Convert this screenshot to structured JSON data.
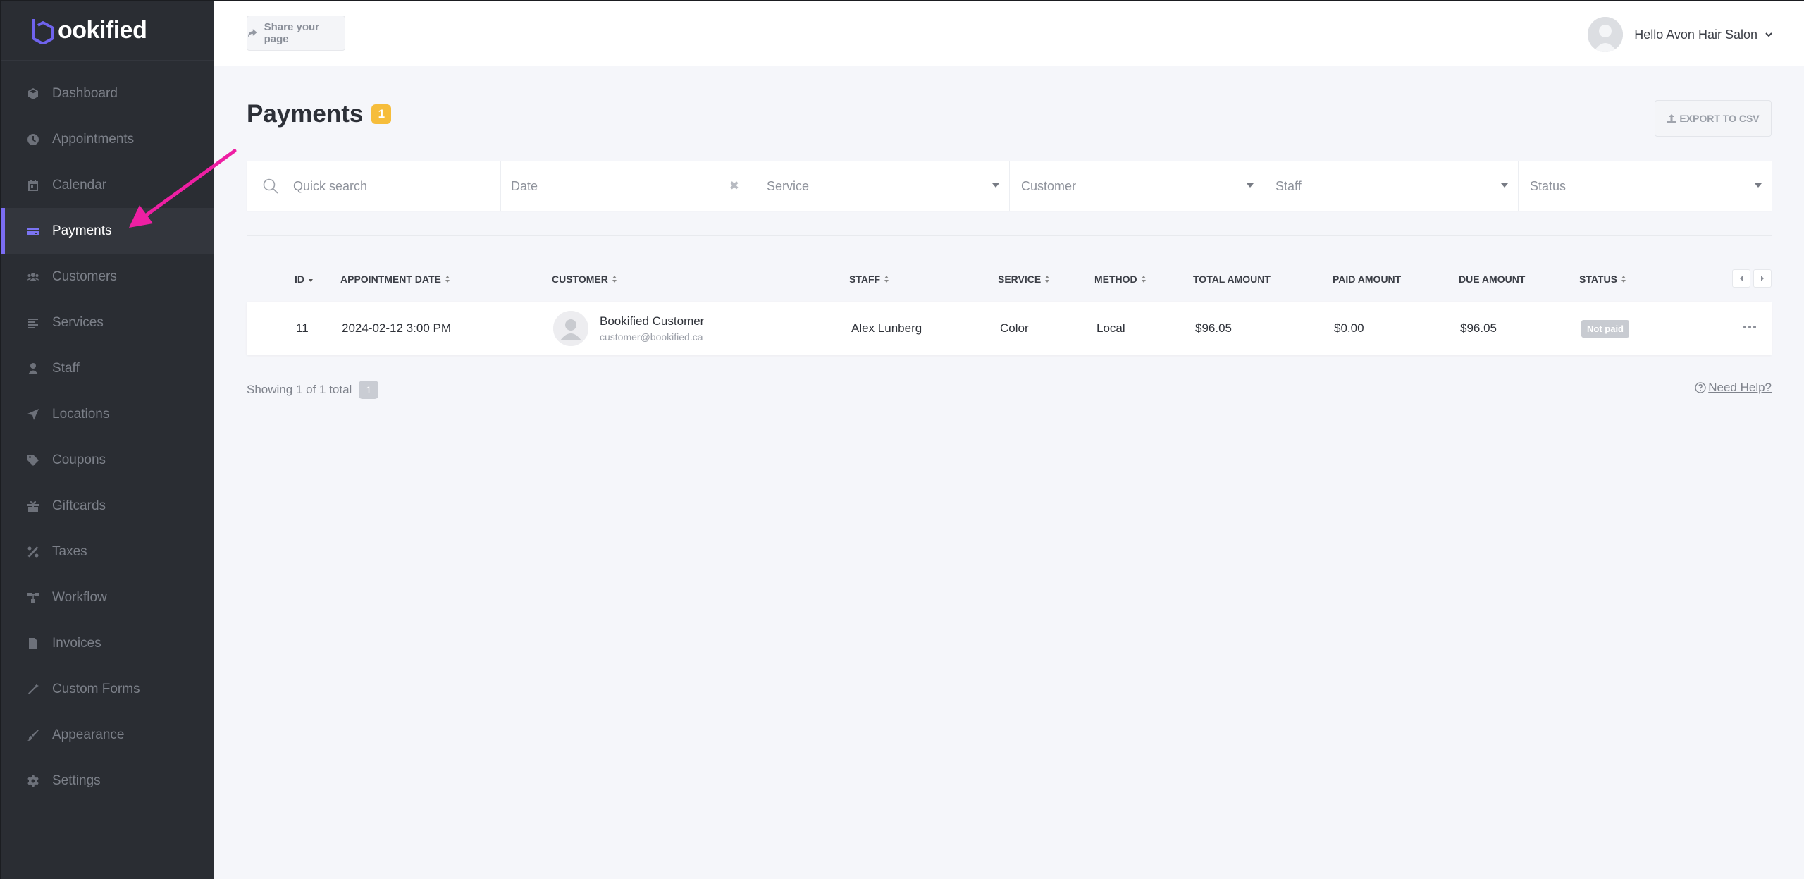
{
  "brand": {
    "name": "ookified",
    "accent": "#7b6df2"
  },
  "sidebar": {
    "items": [
      {
        "label": "Dashboard",
        "icon": "cube-icon"
      },
      {
        "label": "Appointments",
        "icon": "clock-icon"
      },
      {
        "label": "Calendar",
        "icon": "calendar-icon"
      },
      {
        "label": "Payments",
        "icon": "wallet-icon",
        "active": true
      },
      {
        "label": "Customers",
        "icon": "users-icon"
      },
      {
        "label": "Services",
        "icon": "list-icon"
      },
      {
        "label": "Staff",
        "icon": "user-icon"
      },
      {
        "label": "Locations",
        "icon": "location-arrow-icon"
      },
      {
        "label": "Coupons",
        "icon": "tag-icon"
      },
      {
        "label": "Giftcards",
        "icon": "gift-icon"
      },
      {
        "label": "Taxes",
        "icon": "percent-icon"
      },
      {
        "label": "Workflow",
        "icon": "workflow-icon"
      },
      {
        "label": "Invoices",
        "icon": "file-icon"
      },
      {
        "label": "Custom Forms",
        "icon": "magic-wand-icon"
      },
      {
        "label": "Appearance",
        "icon": "brush-icon"
      },
      {
        "label": "Settings",
        "icon": "gear-icon"
      }
    ]
  },
  "topbar": {
    "share_label": "Share your page",
    "user_greeting": "Hello Avon Hair Salon"
  },
  "page": {
    "title": "Payments",
    "count": "1",
    "export_label": "EXPORT TO CSV"
  },
  "filters": {
    "search_placeholder": "Quick search",
    "date_placeholder": "Date",
    "service_placeholder": "Service",
    "customer_placeholder": "Customer",
    "staff_placeholder": "Staff",
    "status_placeholder": "Status"
  },
  "table": {
    "columns": {
      "id": "ID",
      "appointment_date": "APPOINTMENT DATE",
      "customer": "CUSTOMER",
      "staff": "STAFF",
      "service": "SERVICE",
      "method": "METHOD",
      "total_amount": "TOTAL AMOUNT",
      "paid_amount": "PAID AMOUNT",
      "due_amount": "DUE AMOUNT",
      "status": "STATUS"
    },
    "rows": [
      {
        "id": "11",
        "appointment_date": "2024-02-12 3:00 PM",
        "customer_name": "Bookified Customer",
        "customer_email": "customer@bookified.ca",
        "staff": "Alex Lunberg",
        "service": "Color",
        "method": "Local",
        "total_amount": "$96.05",
        "paid_amount": "$0.00",
        "due_amount": "$96.05",
        "status": "Not paid"
      }
    ]
  },
  "footer": {
    "showing": "Showing 1 of 1 total",
    "page": "1",
    "help": "Need Help?"
  },
  "annotation": {
    "arrow_color": "#ee1fa3"
  }
}
